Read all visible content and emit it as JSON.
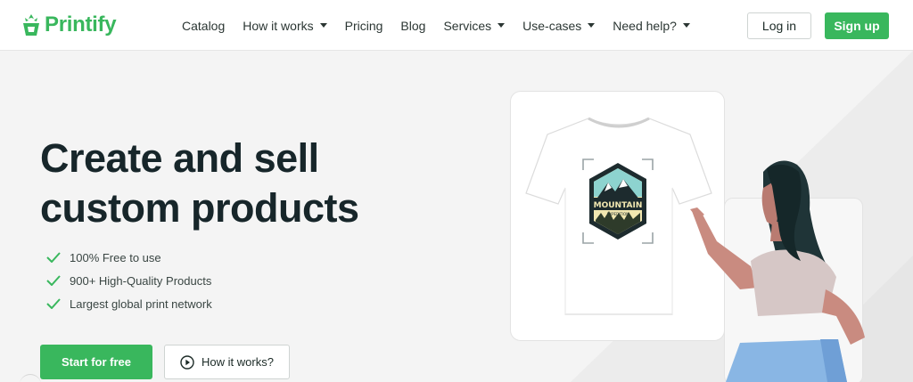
{
  "brand": {
    "name": "Printify",
    "color": "#39b75d"
  },
  "nav": {
    "items": [
      {
        "label": "Catalog",
        "dropdown": false
      },
      {
        "label": "How it works",
        "dropdown": true
      },
      {
        "label": "Pricing",
        "dropdown": false
      },
      {
        "label": "Blog",
        "dropdown": false
      },
      {
        "label": "Services",
        "dropdown": true
      },
      {
        "label": "Use-cases",
        "dropdown": true
      },
      {
        "label": "Need help?",
        "dropdown": true
      }
    ],
    "login_label": "Log in",
    "signup_label": "Sign up"
  },
  "hero": {
    "headline_line1": "Create and sell",
    "headline_line2": "custom products",
    "features": [
      "100% Free to use",
      "900+ High-Quality Products",
      "Largest global print network"
    ],
    "primary_cta": "Start for free",
    "secondary_cta": "How it works?"
  },
  "illustration": {
    "badge_title": "MOUNTAIN",
    "badge_subtitle": "EXPEDITION"
  },
  "icons": {
    "check": "check-icon",
    "play": "play-circle-icon",
    "caret": "chevron-down-icon",
    "logo": "printify-logo-icon"
  }
}
